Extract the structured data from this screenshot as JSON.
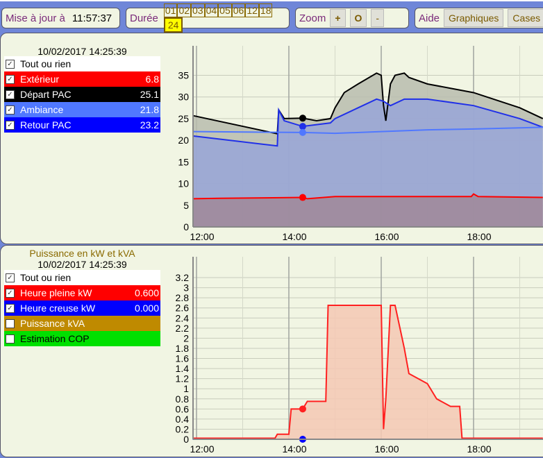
{
  "toolbar": {
    "update_label": "Mise à jour à",
    "update_time": "11:57:37",
    "duration_label": "Durée",
    "durations": [
      "01",
      "02",
      "03",
      "04",
      "05",
      "06",
      "12",
      "18",
      "24"
    ],
    "selected_duration": "24",
    "zoom_label": "Zoom",
    "zoom_in": "+",
    "zoom_reset": "O",
    "zoom_out": "-",
    "help_label": "Aide",
    "graphs_button": "Graphiques",
    "cases_button": "Cases"
  },
  "temp_panel": {
    "timestamp": "10/02/2017 14:25:39",
    "all_label": "Tout ou rien",
    "items": [
      {
        "label": "Extérieur",
        "value": "6.8",
        "color": "#ff0000",
        "checked": true
      },
      {
        "label": "Départ PAC",
        "value": "25.1",
        "color": "#000000",
        "checked": true
      },
      {
        "label": "Ambiance",
        "value": "21.8",
        "color": "#5078ff",
        "checked": true
      },
      {
        "label": "Retour PAC",
        "value": "23.2",
        "color": "#0000ff",
        "checked": true
      }
    ]
  },
  "power_panel": {
    "title": "Puissance en kW et kVA",
    "timestamp": "10/02/2017 14:25:39",
    "all_label": "Tout ou rien",
    "items": [
      {
        "label": "Heure pleine kW",
        "value": "0.600",
        "color": "#ff0000",
        "checked": true
      },
      {
        "label": "Heure creuse kW",
        "value": "0.000",
        "color": "#0000ff",
        "checked": true
      },
      {
        "label": "Puissance kVA",
        "value": "",
        "color": "#bf8a00",
        "checked": false
      },
      {
        "label": "Estimation COP",
        "value": "",
        "color": "#00e000",
        "checked": false
      }
    ]
  },
  "chart_data": [
    {
      "type": "area",
      "xlabel": "",
      "ylabel": "",
      "x_ticks": [
        "12:00",
        "14:00",
        "16:00",
        "18:00"
      ],
      "y_ticks": [
        "0",
        "5",
        "10",
        "15",
        "20",
        "25",
        "30",
        "35"
      ],
      "ylim": [
        0,
        37
      ],
      "xlim": [
        11.92,
        19.5
      ],
      "cursor_x": 14.3,
      "grid": true,
      "series": [
        {
          "name": "Départ PAC",
          "color": "#000000",
          "fill": "#b8bcae",
          "points": [
            [
              11.92,
              25.7
            ],
            [
              13.75,
              21.5
            ],
            [
              13.78,
              27
            ],
            [
              13.9,
              25
            ],
            [
              14.3,
              25.1
            ],
            [
              14.6,
              24.5
            ],
            [
              14.9,
              25
            ],
            [
              15.0,
              27.5
            ],
            [
              15.2,
              31
            ],
            [
              15.5,
              33
            ],
            [
              15.9,
              35.5
            ],
            [
              16.0,
              35
            ],
            [
              16.05,
              28
            ],
            [
              16.1,
              24.5
            ],
            [
              16.2,
              33
            ],
            [
              16.3,
              35
            ],
            [
              16.5,
              35.5
            ],
            [
              16.6,
              34.5
            ],
            [
              17.0,
              33
            ],
            [
              18.0,
              31
            ],
            [
              19.0,
              27.5
            ],
            [
              19.5,
              25
            ]
          ]
        },
        {
          "name": "Retour PAC",
          "color": "#2030e8",
          "fill": "#98a4d8",
          "points": [
            [
              11.92,
              21
            ],
            [
              13.75,
              18.7
            ],
            [
              13.78,
              27
            ],
            [
              13.9,
              24.5
            ],
            [
              14.3,
              23.2
            ],
            [
              14.9,
              24
            ],
            [
              15.0,
              25
            ],
            [
              15.5,
              27.5
            ],
            [
              15.9,
              29.5
            ],
            [
              16.05,
              29
            ],
            [
              16.2,
              28
            ],
            [
              16.5,
              29.5
            ],
            [
              17.0,
              29.5
            ],
            [
              18.0,
              28
            ],
            [
              19.0,
              25
            ],
            [
              19.5,
              23
            ]
          ]
        },
        {
          "name": "Ambiance",
          "color": "#5078ff",
          "fill": "none",
          "points": [
            [
              11.92,
              22
            ],
            [
              14.3,
              21.8
            ],
            [
              15.0,
              21.6
            ],
            [
              16.0,
              22
            ],
            [
              17.0,
              22.4
            ],
            [
              18.0,
              22.6
            ],
            [
              19.5,
              23
            ]
          ]
        },
        {
          "name": "Extérieur",
          "color": "#ff0000",
          "fill": "#a08898",
          "points": [
            [
              11.92,
              6.5
            ],
            [
              12.5,
              6.6
            ],
            [
              13.5,
              6.7
            ],
            [
              14.3,
              6.8
            ],
            [
              14.4,
              6.5
            ],
            [
              15.0,
              7.0
            ],
            [
              16.0,
              7.0
            ],
            [
              17.0,
              7.0
            ],
            [
              17.95,
              7.0
            ],
            [
              18.0,
              7.6
            ],
            [
              18.1,
              7.0
            ],
            [
              19.5,
              6.8
            ]
          ]
        }
      ]
    },
    {
      "type": "area",
      "xlabel": "",
      "ylabel": "",
      "x_ticks": [
        "12:00",
        "14:00",
        "16:00",
        "18:00"
      ],
      "y_ticks": [
        "0",
        "0.2",
        "0.4",
        "0.6",
        "0.8",
        "1",
        "1.2",
        "1.4",
        "1.6",
        "1.8",
        "2",
        "2.2",
        "2.4",
        "2.6",
        "2.8",
        "3",
        "3.2"
      ],
      "ylim": [
        0,
        3.2
      ],
      "xlim": [
        11.92,
        19.5
      ],
      "cursor_x": 14.3,
      "grid": true,
      "series": [
        {
          "name": "Heure pleine kW",
          "color": "#ff2020",
          "fill": "#f5c8b4",
          "points": [
            [
              11.92,
              0.02
            ],
            [
              13.7,
              0.02
            ],
            [
              13.75,
              0.1
            ],
            [
              14.0,
              0.1
            ],
            [
              14.05,
              0.6
            ],
            [
              14.3,
              0.6
            ],
            [
              14.4,
              0.75
            ],
            [
              14.8,
              0.75
            ],
            [
              14.85,
              2.65
            ],
            [
              16.0,
              2.65
            ],
            [
              16.05,
              0.2
            ],
            [
              16.1,
              0.8
            ],
            [
              16.2,
              2.65
            ],
            [
              16.3,
              2.65
            ],
            [
              16.5,
              1.8
            ],
            [
              16.6,
              1.3
            ],
            [
              17.0,
              1.1
            ],
            [
              17.2,
              0.8
            ],
            [
              17.5,
              0.65
            ],
            [
              17.7,
              0.65
            ],
            [
              17.75,
              0.02
            ],
            [
              19.5,
              0.02
            ]
          ]
        },
        {
          "name": "Heure creuse kW",
          "color": "#0000ff",
          "fill": "none",
          "points": [
            [
              11.92,
              0
            ],
            [
              19.5,
              0
            ]
          ]
        }
      ]
    }
  ]
}
